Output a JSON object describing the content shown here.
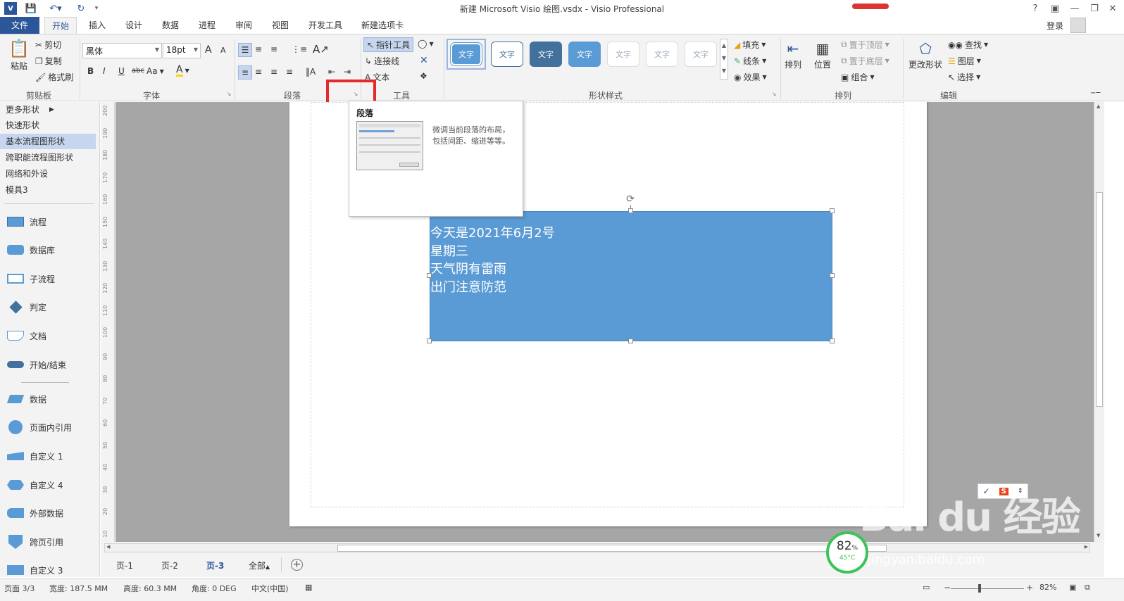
{
  "titlebar": {
    "title": "新建 Microsoft Visio 绘图.vsdx - Visio Professional",
    "help": "?",
    "login": "登录"
  },
  "tabs": [
    "文件",
    "开始",
    "插入",
    "设计",
    "数据",
    "进程",
    "审阅",
    "视图",
    "开发工具",
    "新建选项卡"
  ],
  "ribbon": {
    "clipboard": {
      "paste": "粘贴",
      "cut": "剪切",
      "copy": "复制",
      "format_painter": "格式刷",
      "label": "剪贴板"
    },
    "font": {
      "family": "黑体",
      "size": "18pt",
      "bold": "B",
      "italic": "I",
      "underline": "U",
      "strike": "abc",
      "case": "Aa",
      "color": "A",
      "grow": "A",
      "shrink": "A",
      "label": "字体"
    },
    "paragraph": {
      "label": "段落"
    },
    "tools": {
      "pointer": "指针工具",
      "connector": "连接线",
      "text": "文本",
      "label": "工具"
    },
    "shape_styles": {
      "sample": "文字",
      "fill": "填充",
      "line": "线条",
      "effect": "效果",
      "label": "形状样式"
    },
    "arrange": {
      "arrange": "排列",
      "position": "位置",
      "bring_front": "置于顶层",
      "send_back": "置于底层",
      "group": "组合",
      "label": "排列"
    },
    "editing": {
      "change_shape": "更改形状",
      "find": "查找",
      "layers": "图层",
      "select": "选择",
      "label": "编辑"
    }
  },
  "shapes_panel": {
    "categories": [
      "更多形状",
      "快速形状",
      "基本流程图形状",
      "跨职能流程图形状",
      "网络和外设",
      "模具3"
    ],
    "selected_category": "基本流程图形状",
    "items": [
      "流程",
      "数据库",
      "子流程",
      "判定",
      "文档",
      "开始/结束",
      "数据",
      "页面内引用",
      "自定义 1",
      "自定义 4",
      "外部数据",
      "跨页引用",
      "自定义 3"
    ]
  },
  "ruler_ticks": [
    "200",
    "190",
    "180",
    "170",
    "160",
    "150",
    "140",
    "130",
    "120",
    "110",
    "100",
    "90",
    "80",
    "70",
    "60",
    "50",
    "40",
    "30",
    "20",
    "10"
  ],
  "shape_text": [
    "今天是2021年6月2号",
    "星期三",
    "天气阴有雷雨",
    "出门注意防范"
  ],
  "tooltip": {
    "title": "段落",
    "desc_line1": "微调当前段落的布局，",
    "desc_line2": "包括间距、缩进等等。"
  },
  "page_tabs": [
    "页-1",
    "页-2",
    "页-3",
    "全部"
  ],
  "active_page_tab": "页-3",
  "status": {
    "page": "页面 3/3",
    "width": "宽度: 187.5 MM",
    "height": "高度: 60.3 MM",
    "angle": "角度: 0 DEG",
    "language": "中文(中国)",
    "zoom": "82%"
  },
  "widgets": {
    "zoom_ring_value": "82",
    "zoom_ring_unit": "%",
    "zoom_ring_temp": "45°C",
    "watermark": "Bai du 经验",
    "watermark_url": "jingyan.baidu.com"
  },
  "colors": {
    "accent": "#2b579a",
    "shape_fill": "#5b9bd5",
    "highlight": "#e52a2a",
    "ring": "#3cc35a"
  }
}
